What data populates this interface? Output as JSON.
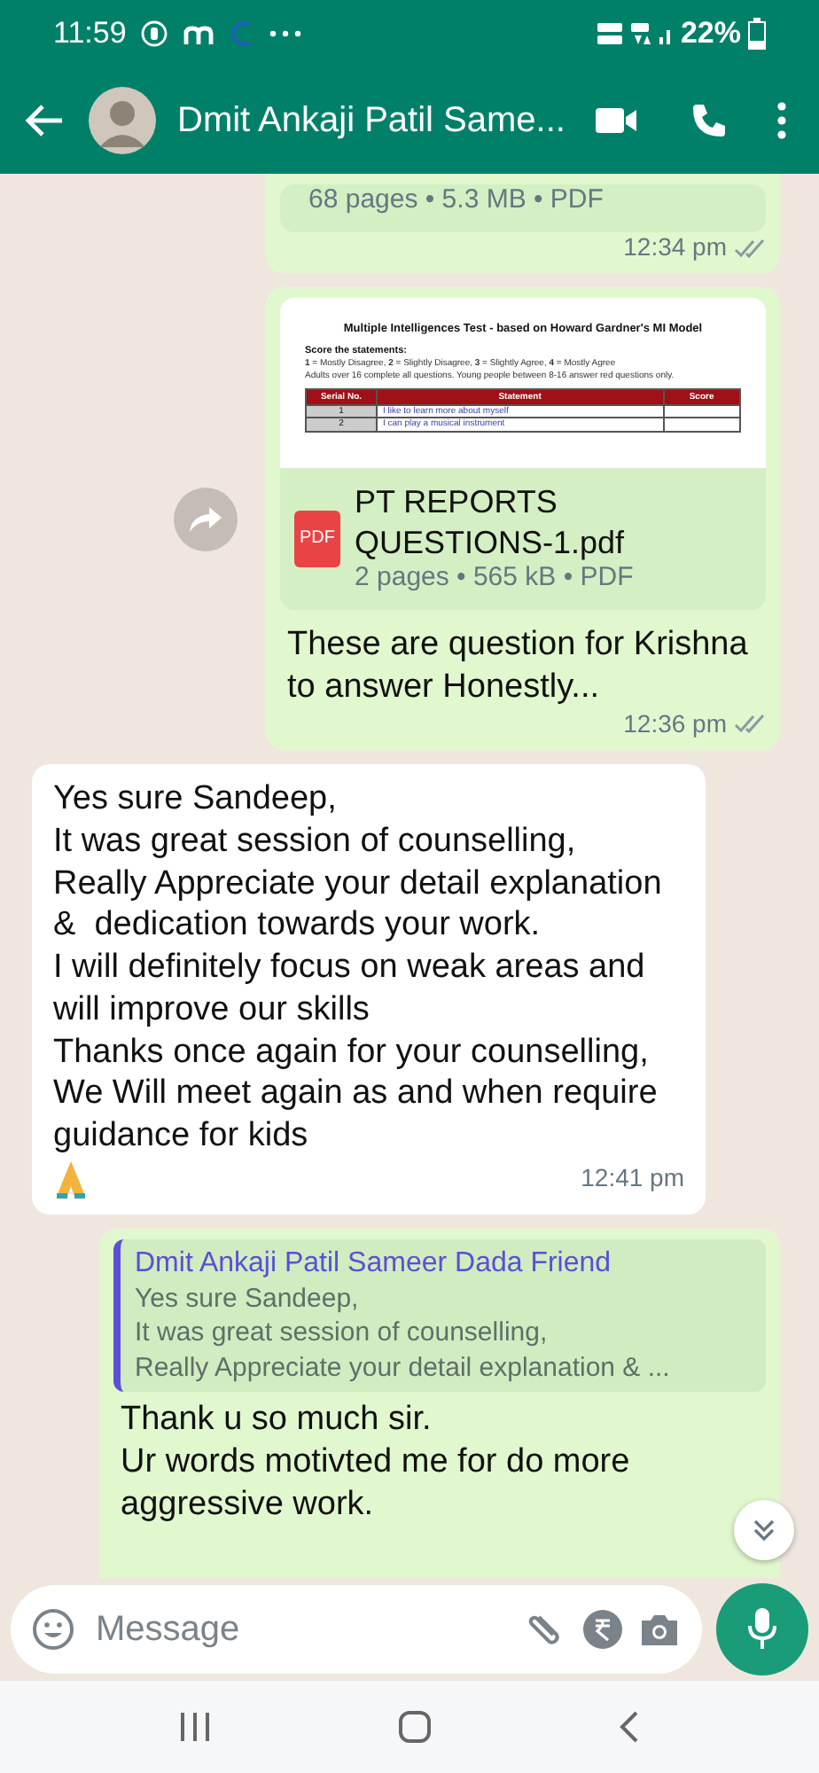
{
  "status_bar": {
    "time": "11:59",
    "battery_percent": "22%"
  },
  "header": {
    "title": "Dmit Ankaji Patil Same..."
  },
  "messages": [
    {
      "kind": "document",
      "outgoing": true,
      "meta": "68 pages • 5.3 MB • PDF",
      "time": "12:34 pm",
      "double_tick": true,
      "read": false
    },
    {
      "kind": "document",
      "outgoing": true,
      "forward_button": true,
      "preview": {
        "title": "Multiple Intelligences Test - based on Howard Gardner's MI Model",
        "subtitle": "Score the statements:",
        "scale": "**1** = Mostly Disagree, **2** = Slightly Disagree, **3** = Slightly Agree, **4** = Mostly Agree",
        "note": "Adults over 16 complete all questions. Young people between 8-16 answer red questions only.",
        "columns": [
          "Serial No.",
          "Statement",
          "Score"
        ],
        "rows": [
          [
            "1",
            "I like to learn more about myself",
            ""
          ],
          [
            "2",
            "I can play a musical instrument",
            ""
          ]
        ]
      },
      "file_type_label": "PDF",
      "file_name": "PT REPORTS QUESTIONS-1.pdf",
      "meta": "2 pages • 565 kB • PDF",
      "caption": "These are question for Krishna to answer Honestly...",
      "time": "12:36 pm",
      "double_tick": true,
      "read": false
    },
    {
      "kind": "text",
      "outgoing": false,
      "text": "Yes sure Sandeep,\nIt was great session of counselling,\nReally Appreciate your detail explanation &  dedication towards your work.\nI will definitely focus on weak areas and will improve our skills\nThanks once again for your counselling,\nWe Will meet again as and when require guidance for kids",
      "praying_hands_emoji": true,
      "time": "12:41 pm"
    },
    {
      "kind": "reply",
      "outgoing": true,
      "quote_author": "Dmit Ankaji Patil Sameer Dada Friend",
      "quote_text": "Yes sure Sandeep,\nIt was great session of counselling,\nReally Appreciate your detail explanation & ...",
      "text": "Thank u so much sir.\nUr words motivted me for do more\naggressive work."
    }
  ],
  "composer": {
    "placeholder": "Message"
  }
}
